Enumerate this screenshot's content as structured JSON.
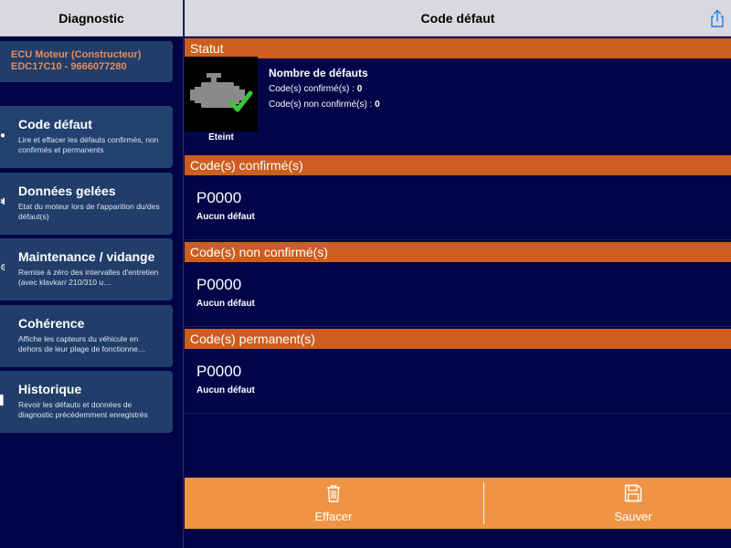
{
  "sidebar": {
    "title": "Diagnostic",
    "ecu": {
      "line1": "ECU Moteur (Constructeur)",
      "line2": "EDC17C10 - 9666077280"
    },
    "items": [
      {
        "title": "Code défaut",
        "desc": "Lire et effacer les défauts confirmés, non confirmés et permanents"
      },
      {
        "title": "Données gelées",
        "desc": "Etat du moteur lors de l'apparition du/des défaut(s)"
      },
      {
        "title": "Maintenance / vidange",
        "desc": "Remise à zéro des intervalles d'entretien (avec klavkarr 210/310 u…"
      },
      {
        "title": "Cohérence",
        "desc": "Affiche les capteurs du véhicule en dehors de leur plage de fonctionne…"
      },
      {
        "title": "Historique",
        "desc": "Revoir les défauts et données de diagnostic précédemment enregistrés"
      }
    ]
  },
  "main": {
    "title": "Code défaut",
    "status": {
      "section_label": "Statut",
      "engine_state": "Eteint",
      "count_title": "Nombre de défauts",
      "confirmed_label": "Code(s) confirmé(s) : ",
      "confirmed_count": "0",
      "unconfirmed_label": "Code(s) non confirmé(s) : ",
      "unconfirmed_count": "0"
    },
    "sections": [
      {
        "label": "Code(s) confirmé(s)",
        "code": "P0000",
        "desc": "Aucun défaut"
      },
      {
        "label": "Code(s) non confirmé(s)",
        "code": "P0000",
        "desc": "Aucun défaut"
      },
      {
        "label": "Code(s) permanent(s)",
        "code": "P0000",
        "desc": "Aucun défaut"
      }
    ],
    "actions": {
      "clear_label": "Effacer",
      "save_label": "Sauver"
    }
  },
  "icons": {
    "share": "share-icon",
    "engine": "engine-check-icon",
    "trash": "trash-icon",
    "save": "floppy-disk-icon"
  },
  "colors": {
    "background": "#010446",
    "header": "#d9d9dd",
    "section_bar": "#cd5e1f",
    "sidebar_item": "#213e6a",
    "ecu_text": "#e38c5e",
    "action_bar": "#ef9445",
    "check_green": "#3cc43c",
    "share_blue": "#1a7cf5"
  }
}
